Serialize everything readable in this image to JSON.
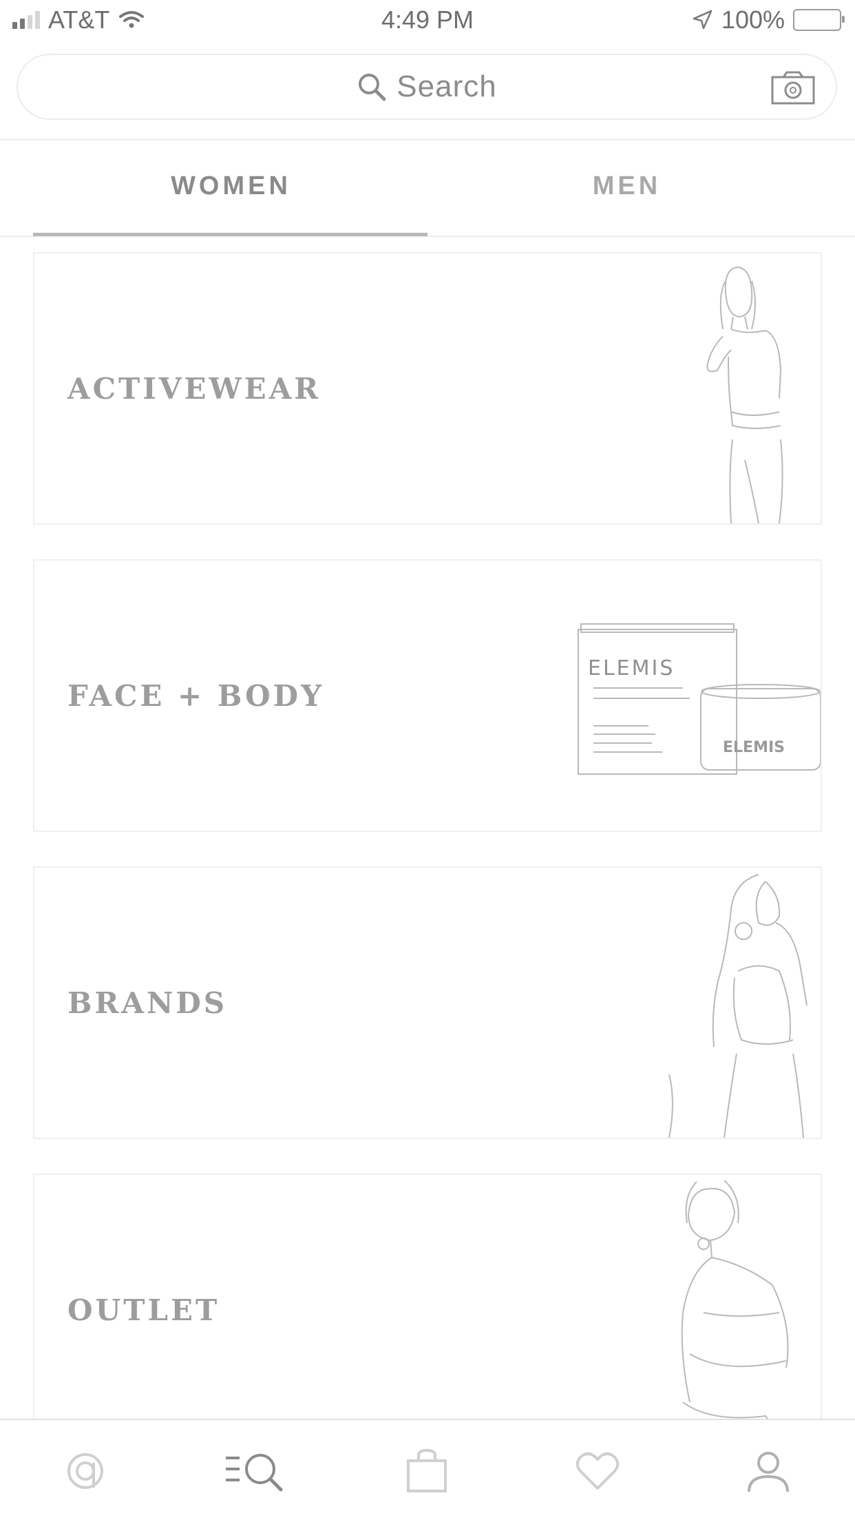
{
  "status_bar": {
    "carrier": "AT&T",
    "time": "4:49 PM",
    "battery": "100%"
  },
  "search": {
    "placeholder": "Search"
  },
  "tabs": [
    {
      "label": "WOMEN",
      "selected": true
    },
    {
      "label": "MEN",
      "selected": false
    }
  ],
  "categories": [
    {
      "label": "ACTIVEWEAR",
      "image_icon": "model-sports-bra-image"
    },
    {
      "label": "FACE + BODY",
      "image_icon": "elemis-skincare-product-image"
    },
    {
      "label": "BRANDS",
      "image_icon": "model-curly-hair-image"
    },
    {
      "label": "OUTLET",
      "image_icon": "model-crouching-image"
    }
  ],
  "product_text": {
    "brand": "ELEMIS"
  },
  "bottom_nav": [
    {
      "icon": "home-logo-icon"
    },
    {
      "icon": "browse-search-icon",
      "selected": true
    },
    {
      "icon": "shopping-bag-icon"
    },
    {
      "icon": "heart-icon"
    },
    {
      "icon": "profile-icon"
    }
  ],
  "colors": {
    "background": "#ffffff",
    "text": "#8a8a8a",
    "border": "#ececec",
    "underline": "#b8b8b8"
  }
}
